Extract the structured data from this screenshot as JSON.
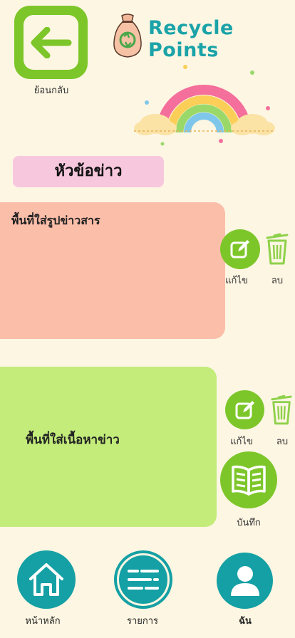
{
  "header": {
    "back_label": "ย้อนกลับ",
    "app_title": "Recycle Points"
  },
  "news": {
    "headline_label": "หัวข้อข่าว",
    "image_area_label": "พื้นที่ใส่รูปข่าวสาร",
    "content_area_label": "พื้นที่ใส่เนื้อหาข่าว",
    "edit_label": "แก้ไข",
    "delete_label": "ลบ",
    "save_label": "บันทึก"
  },
  "bottom_nav": {
    "home_label": "หน้าหลัก",
    "list_label": "รายการ",
    "me_label": "ฉัน"
  },
  "colors": {
    "background": "#fdf6e3",
    "accent_green": "#7dc62a",
    "accent_teal": "#14a0a4",
    "headline_bg": "#f7c8dd",
    "image_area_bg": "#fbbea9",
    "content_area_bg": "#c3ec7b"
  },
  "icons": [
    "arrow-left-icon",
    "recycle-bag-icon",
    "rainbow-illustration",
    "edit-icon",
    "trash-icon",
    "book-icon",
    "home-icon",
    "list-icon",
    "user-icon"
  ]
}
